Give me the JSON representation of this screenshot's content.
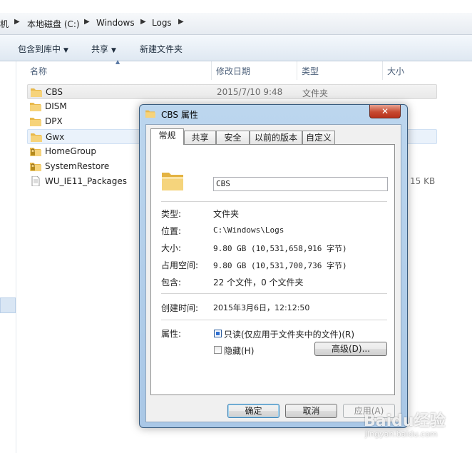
{
  "address": {
    "crumbs": [
      "机",
      "本地磁盘 (C:)",
      "Windows",
      "Logs"
    ]
  },
  "toolbar": {
    "include_label": "包含到库中",
    "share_label": "共享",
    "new_folder_label": "新建文件夹"
  },
  "columns": {
    "name": "名称",
    "date": "修改日期",
    "type": "类型",
    "size": "大小"
  },
  "files": [
    {
      "name": "CBS",
      "date": "2015/7/10 9:48",
      "type": "文件夹",
      "size": "",
      "icon": "folder-icon"
    },
    {
      "name": "DISM",
      "date": "",
      "type": "",
      "size": "",
      "icon": "folder-icon"
    },
    {
      "name": "DPX",
      "date": "",
      "type": "",
      "size": "",
      "icon": "folder-icon"
    },
    {
      "name": "Gwx",
      "date": "",
      "type": "",
      "size": "",
      "icon": "folder-icon"
    },
    {
      "name": "HomeGroup",
      "date": "",
      "type": "",
      "size": "",
      "icon": "locked-folder-icon"
    },
    {
      "name": "SystemRestore",
      "date": "",
      "type": "",
      "size": "",
      "icon": "locked-folder-icon"
    },
    {
      "name": "WU_IE11_Packages",
      "date": "",
      "type": "",
      "size": "15 KB",
      "icon": "file-icon"
    }
  ],
  "dialog": {
    "title": "CBS 属性",
    "close_label": "✕",
    "tabs": [
      "常规",
      "共享",
      "安全",
      "以前的版本",
      "自定义"
    ],
    "active_tab": "常规",
    "name_value": "CBS",
    "props": [
      {
        "label": "类型:",
        "value": "文件夹"
      },
      {
        "label": "位置:",
        "value": "C:\\Windows\\Logs"
      },
      {
        "label": "大小:",
        "value": "9.80 GB (10,531,658,916 字节)"
      },
      {
        "label": "占用空间:",
        "value": "9.80 GB (10,531,700,736 字节)"
      },
      {
        "label": "包含:",
        "value": "22 个文件，0 个文件夹"
      }
    ],
    "created": {
      "label": "创建时间:",
      "value": "2015年3月6日，12:12:50"
    },
    "attributes": {
      "label": "属性:",
      "readonly_label": "只读(仅应用于文件夹中的文件)(R)",
      "hidden_label": "隐藏(H)",
      "advanced_label": "高级(D)..."
    },
    "buttons": {
      "ok": "确定",
      "cancel": "取消",
      "apply": "应用(A)"
    }
  },
  "watermark": {
    "text": "Baidu经验",
    "url_text": "jingyan.baidu.com"
  }
}
